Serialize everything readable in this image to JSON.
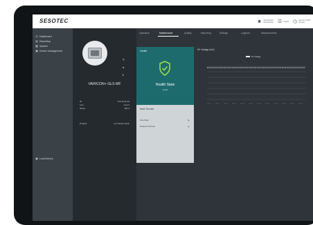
{
  "brand": {
    "logo": "SESOTEC"
  },
  "topbar": {
    "user_lines": [
      "Administrator",
      "Administrator"
    ],
    "logout_label": "Logout",
    "info_lines": [
      "Sesotec GmbH",
      "Sesotec"
    ]
  },
  "sidebar": {
    "items": [
      {
        "label": "Dashboard",
        "icon": "dashboard-icon"
      },
      {
        "label": "Reporting",
        "icon": "reporting-icon"
      },
      {
        "label": "System",
        "icon": "system-icon"
      },
      {
        "label": "Device management",
        "icon": "device-management-icon"
      }
    ],
    "bottom_item": {
      "label": "Lock/Unlock",
      "icon": "lock-icon"
    }
  },
  "device": {
    "name": "VARICON+ GLS MF",
    "rows": [
      {
        "label": "IP",
        "value": "172.16.10.16"
      },
      {
        "label": "Line",
        "value": "Line 2"
      },
      {
        "label": "Name",
        "value": "MD 4"
      }
    ],
    "product_label": "Product",
    "product_value": "(1) Cheese block"
  },
  "tabs": [
    {
      "label": "Operation",
      "active": false
    },
    {
      "label": "Maintenance",
      "active": true
    },
    {
      "label": "Quality",
      "active": false
    },
    {
      "label": "Reporting",
      "active": false
    },
    {
      "label": "Settings",
      "active": false
    },
    {
      "label": "Logbook",
      "active": false
    },
    {
      "label": "Measurements",
      "active": false
    }
  ],
  "health": {
    "title": "Health",
    "state_title": "Health State",
    "state_sub": "Good"
  },
  "service": {
    "title": "Next Service",
    "rows": [
      {
        "label": "Due Date",
        "icon": "edit-icon"
      },
      {
        "label": "Request Service",
        "icon": "request-icon"
      }
    ]
  },
  "chart": {
    "title": "5V Voltage (mV)",
    "legend": "5V Voltage"
  },
  "colors": {
    "health_card": "#1e6b6e",
    "sidebar": "#3b4247",
    "device_panel": "#252a2e",
    "content_bg": "#2e3439"
  }
}
